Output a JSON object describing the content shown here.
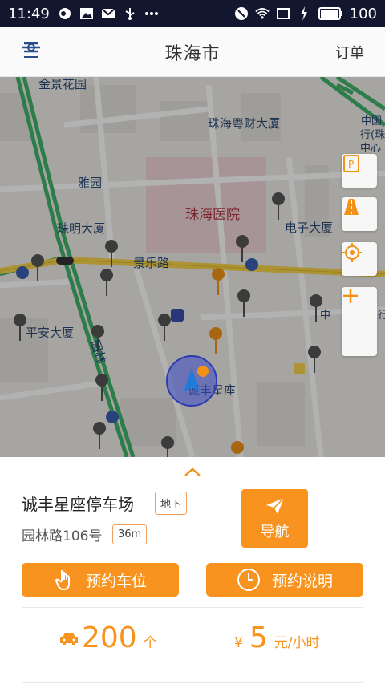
{
  "status_bar": {
    "time": "11:49",
    "battery": "100",
    "icons_left": [
      "notification-icon",
      "image-icon",
      "mail-icon",
      "usb-icon",
      "more-icon"
    ],
    "icons_right": [
      "mute-icon",
      "wifi-icon",
      "sim-icon",
      "charging-icon",
      "battery-icon"
    ]
  },
  "header": {
    "title": "珠海市",
    "orders_label": "订单",
    "logo_icon": "app-logo-icon"
  },
  "map": {
    "labels": [
      "金景花园",
      "珠海粤财大厦",
      "雅园",
      "珠海医院",
      "电子大厦",
      "珠明大厦",
      "景乐路",
      "平安大厦",
      "园林",
      "诚丰星座",
      "中国",
      "行(珠",
      "中心",
      "中",
      "银行"
    ],
    "controls": [
      "parking-icon",
      "road-icon",
      "locate-icon",
      "zoom-in-icon",
      "zoom-out-icon"
    ],
    "colors": {
      "road_major": "#f6d54b",
      "road_green": "#3fb36a",
      "pin_gray": "#555555",
      "pin_orange": "#f39219"
    }
  },
  "lot": {
    "name": "诚丰星座停车场",
    "level_tag": "地下",
    "address": "园林路106号",
    "distance_tag": "36m",
    "nav_label": "导航"
  },
  "actions": {
    "reserve_spot": "预约车位",
    "reserve_info": "预约说明"
  },
  "stats": {
    "spots": "200",
    "spots_unit": "个",
    "currency": "¥",
    "price": "5",
    "price_unit": "元/小时"
  },
  "accent_color": "#f7931e"
}
